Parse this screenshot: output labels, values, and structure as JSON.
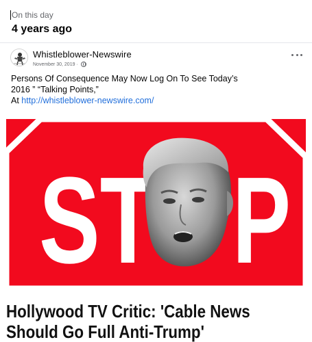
{
  "memory": {
    "label": "On this day",
    "title": "4 years ago"
  },
  "post": {
    "author": "Whistleblower-Newswire",
    "date": "November 30, 2019",
    "date_separator": "·",
    "privacy_icon": "globe-icon",
    "more_icon": "more-options-icon",
    "text_line1": "Persons Of Consequence May Now Log On To See Today’s",
    "text_line2": "2016 ” “Talking Points,”",
    "text_prefix": "At ",
    "link": "http://whistleblower-newswire.com/"
  },
  "image": {
    "sign_text_left": "ST",
    "sign_text_right": "P",
    "sign_color": "#f20a1e",
    "face_description_icon": "face-photo"
  },
  "headline": {
    "line1": "Hollywood TV Critic: 'Cable News",
    "line2": "Should Go Full Anti-Trump'"
  }
}
